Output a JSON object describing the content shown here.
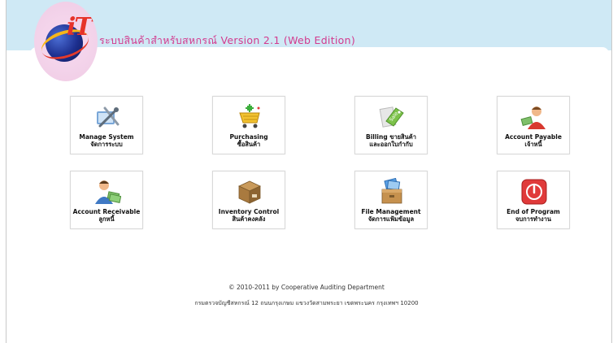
{
  "app": {
    "logo_text": "iT",
    "title": "ระบบสินค้าสำหรับสหกรณ์ Version 2.1 (Web Edition)"
  },
  "menu": [
    {
      "label": "Manage System",
      "sub": "จัดการระบบ",
      "icon": "tools-icon"
    },
    {
      "label": "Purchasing",
      "sub": "ซื้อสินค้า",
      "icon": "shopping-cart-icon"
    },
    {
      "label": "Billing ขายสินค้า",
      "sub": "และออกใบกำกับ",
      "icon": "sale-tag-icon"
    },
    {
      "label": "Account Payable",
      "sub": "เจ้าหนี้",
      "icon": "person-money-icon"
    },
    {
      "label": "Account Receivable",
      "sub": "ลูกหนี้",
      "icon": "person-money-receivable-icon"
    },
    {
      "label": "Inventory Control",
      "sub": "สินค้าคงคลัง",
      "icon": "box-icon"
    },
    {
      "label": "File Management",
      "sub": "จัดการแฟ้มข้อมูล",
      "icon": "file-box-icon"
    },
    {
      "label": "End of Program",
      "sub": "จบการทำงาน",
      "icon": "power-icon"
    }
  ],
  "footer": {
    "copyright": "© 2010-2011 by Cooperative Auditing Department",
    "address": "กรมตรวจบัญชีสหกรณ์ 12 ถนนกรุงเกษม แขวงวัดสามพระยา เขตพระนคร กรุงเทพฯ 10200"
  },
  "colors": {
    "header_band": "#cfe9f5",
    "title_text": "#d33a8e",
    "power_red": "#e03a3a"
  }
}
